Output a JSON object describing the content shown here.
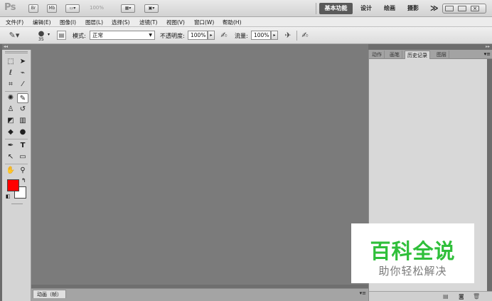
{
  "app": {
    "logo": "Ps",
    "bridge_label": "Br",
    "minibridge_label": "Mb",
    "zoom": "100%",
    "workspaces": [
      "基本功能",
      "设计",
      "绘画",
      "摄影"
    ],
    "workspaces_more": "≫"
  },
  "menu": [
    "文件(F)",
    "编辑(E)",
    "图像(I)",
    "图层(L)",
    "选择(S)",
    "滤镜(T)",
    "视图(V)",
    "窗口(W)",
    "帮助(H)"
  ],
  "options": {
    "brush_size": "35",
    "mode_label": "模式:",
    "mode_value": "正常",
    "opacity_label": "不透明度:",
    "opacity_value": "100%",
    "flow_label": "流量:",
    "flow_value": "100%"
  },
  "panels": {
    "right_tabs": [
      "动作",
      "画笔",
      "历史记录",
      "图层"
    ],
    "active_tab": "历史记录",
    "bottom_tab": "动画（帧）"
  },
  "colors": {
    "foreground": "#ff0000",
    "background": "#ffffff",
    "canvas": "#7b7b7b",
    "active_workspace": "#5a5a5a"
  },
  "watermark": {
    "main": "百科全说",
    "sub": "助你轻松解决"
  },
  "icons": [
    "marquee-icon",
    "move-icon",
    "lasso-icon",
    "quick-select-icon",
    "crop-icon",
    "eyedropper-icon",
    "healing-icon",
    "brush-icon",
    "stamp-icon",
    "history-brush-icon",
    "eraser-icon",
    "gradient-icon",
    "blur-icon",
    "dodge-icon",
    "pen-icon",
    "type-icon",
    "path-select-icon",
    "shape-icon",
    "hand-icon",
    "zoom-icon"
  ]
}
